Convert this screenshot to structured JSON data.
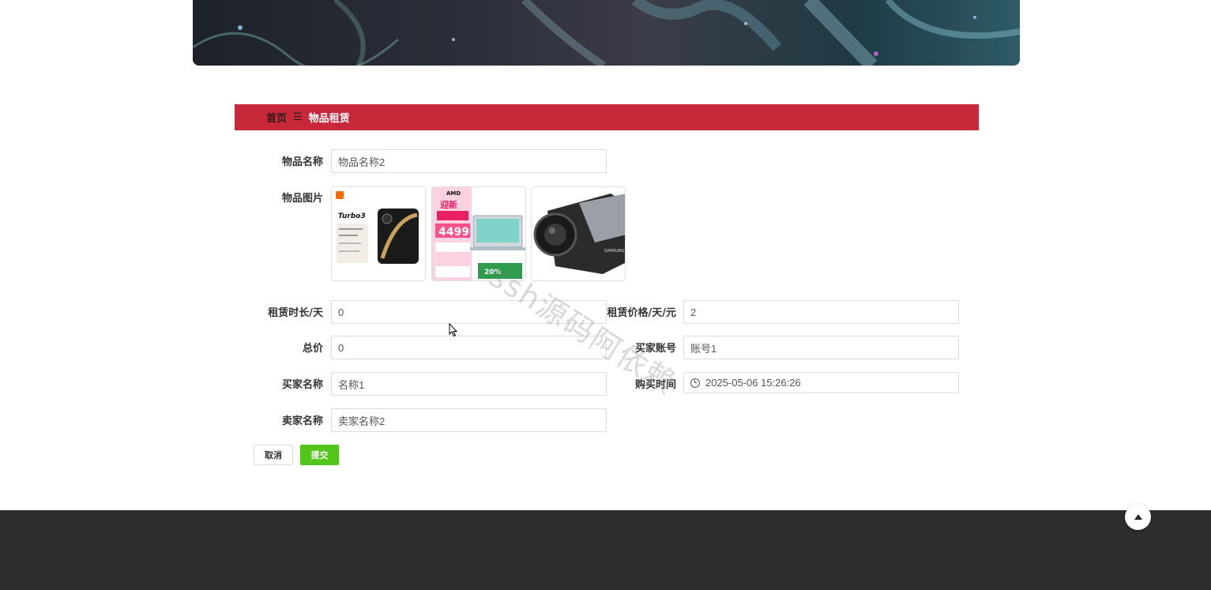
{
  "breadcrumb": {
    "home": "首页",
    "separator": "☰",
    "current": "物品租赁"
  },
  "form": {
    "item_name": {
      "label": "物品名称",
      "value": "物品名称2"
    },
    "item_images": {
      "label": "物品图片",
      "thumb1_text": "Turbo3",
      "thumb2_price": "4499",
      "thumb2_brand": "AMD",
      "thumb2_title": "迎新",
      "thumb3_brand": "SAMSUNG"
    },
    "rental_days": {
      "label": "租赁时长/天",
      "value": "0"
    },
    "rental_price": {
      "label": "租赁价格/天/元",
      "value": "2"
    },
    "total_price": {
      "label": "总价",
      "value": "0"
    },
    "buyer_account": {
      "label": "买家账号",
      "value": "账号1"
    },
    "buyer_name": {
      "label": "买家名称",
      "value": "名称1"
    },
    "purchase_time": {
      "label": "购买时间",
      "value": "2025-05-06 15:26:26",
      "icon": "clock-icon"
    },
    "seller_name": {
      "label": "卖家名称",
      "value": "卖家名称2"
    }
  },
  "buttons": {
    "cancel": "取消",
    "submit": "提交"
  },
  "watermark": "ssh源码阿依赖",
  "colors": {
    "accent": "#c9283a",
    "submit": "#52c41a",
    "footer": "#2d2d2d"
  }
}
